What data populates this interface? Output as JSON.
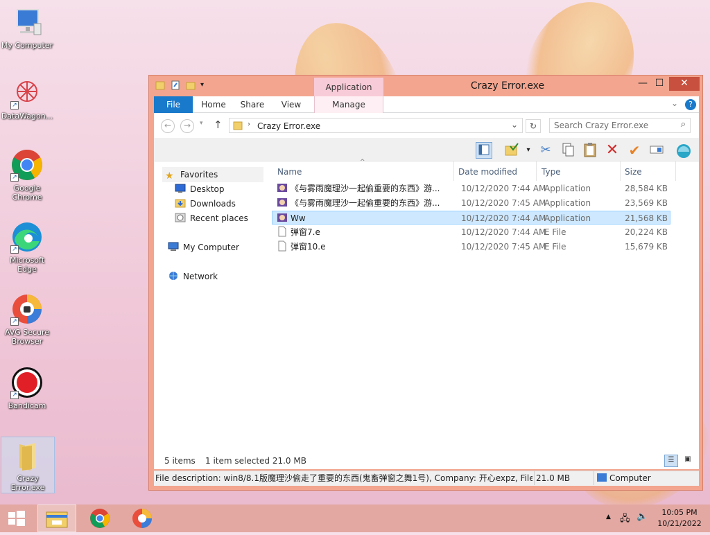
{
  "desktop": {
    "icons": [
      {
        "label": "My Computer"
      },
      {
        "label": "DataWagon..."
      },
      {
        "label": "Google Chrome"
      },
      {
        "label": "Microsoft Edge"
      },
      {
        "label": "AVG Secure Browser"
      },
      {
        "label": "Bandicam"
      },
      {
        "label": "Crazy Error.exe"
      }
    ]
  },
  "window": {
    "title": "Crazy Error.exe",
    "context_tab": "Application Tools",
    "controls": {
      "minimize": "—",
      "maximize": "☐",
      "close": "✕"
    },
    "ribbon_tabs": [
      "File",
      "Home",
      "Share",
      "View",
      "Manage"
    ],
    "address": {
      "path": "Crazy Error.exe",
      "search_placeholder": "Search Crazy Error.exe"
    },
    "nav": {
      "favorites": "Favorites",
      "desktop": "Desktop",
      "downloads": "Downloads",
      "recent": "Recent places",
      "computer": "My Computer",
      "network": "Network"
    },
    "columns": {
      "name": "Name",
      "date": "Date modified",
      "type": "Type",
      "size": "Size"
    },
    "files": [
      {
        "name": "《与雾雨魔理沙一起偷重要的东西》游...",
        "date": "10/12/2020 7:44 AM",
        "type": "Application",
        "size": "28,584 KB"
      },
      {
        "name": "《与雾雨魔理沙一起偷重要的东西》游...",
        "date": "10/12/2020 7:45 AM",
        "type": "Application",
        "size": "23,569 KB"
      },
      {
        "name": "Ww",
        "date": "10/12/2020 7:44 AM",
        "type": "Application",
        "size": "21,568 KB"
      },
      {
        "name": "弹窗7.e",
        "date": "10/12/2020 7:44 AM",
        "type": "E File",
        "size": "20,224 KB"
      },
      {
        "name": "弹窗10.e",
        "date": "10/12/2020 7:45 AM",
        "type": "E File",
        "size": "15,679 KB"
      }
    ],
    "status": {
      "items": "5 items",
      "selected": "1 item selected  21.0 MB"
    },
    "info": {
      "description": "File description: win8/8.1版魔理沙偷走了重要的东西(鬼畜弹窗之舞1号), Company: 开心expz, File ve",
      "size": "21.0 MB",
      "location": "Computer"
    }
  },
  "taskbar": {
    "time": "10:05 PM",
    "date": "10/21/2022"
  }
}
